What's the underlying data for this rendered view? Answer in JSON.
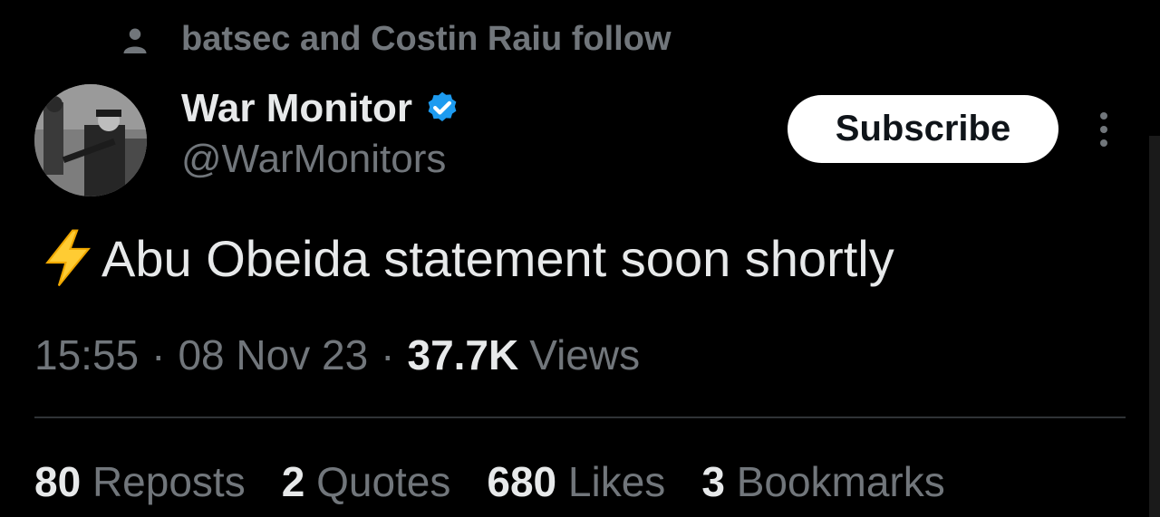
{
  "social_context": {
    "text": "batsec and Costin Raiu follow",
    "icon": "person-icon"
  },
  "author": {
    "name": "War Monitor",
    "handle": "@WarMonitors",
    "verified_icon": "verified-badge-icon",
    "verified_color": "#1d9bf0"
  },
  "actions": {
    "subscribe_label": "Subscribe",
    "more_icon": "more-vertical-icon"
  },
  "tweet": {
    "emoji": "⚡",
    "text": "Abu Obeida statement soon shortly"
  },
  "meta": {
    "time": "15:55",
    "date": "08 Nov 23",
    "views_count": "37.7K",
    "views_label": "Views",
    "separator": "·"
  },
  "stats": [
    {
      "count": "80",
      "label": "Reposts"
    },
    {
      "count": "2",
      "label": "Quotes"
    },
    {
      "count": "680",
      "label": "Likes"
    },
    {
      "count": "3",
      "label": "Bookmarks"
    }
  ],
  "colors": {
    "background": "#000000",
    "text": "#e7e9ea",
    "secondary": "#71767b",
    "accent": "#1d9bf0"
  }
}
